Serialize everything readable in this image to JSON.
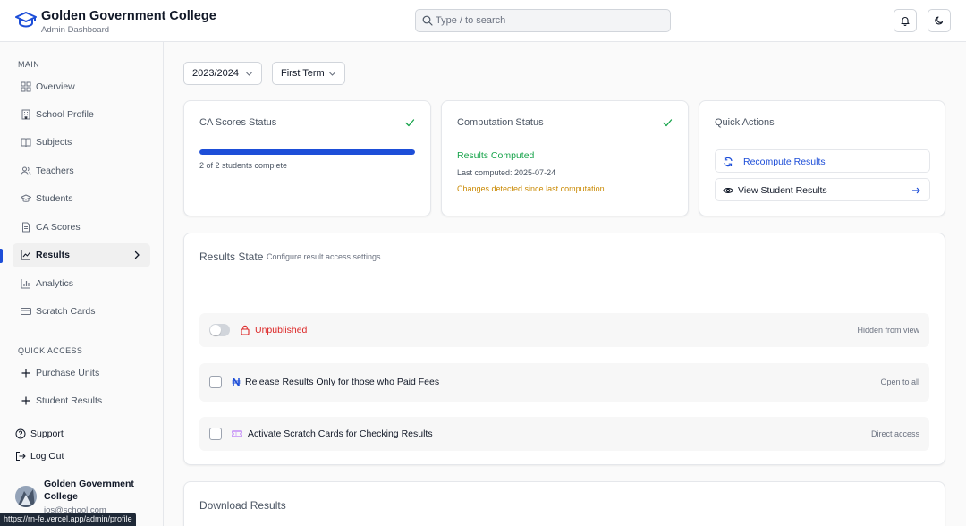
{
  "header": {
    "title": "Golden Government College",
    "subtitle": "Admin Dashboard",
    "search_placeholder": "Type / to search",
    "logo_icon": "graduation-cap-icon",
    "notification_icon": "bell-icon",
    "theme_icon": "moon-icon"
  },
  "sidebar": {
    "main_label": "MAIN",
    "items": [
      {
        "label": "Overview",
        "icon": "grid-icon"
      },
      {
        "label": "School Profile",
        "icon": "building-icon"
      },
      {
        "label": "Subjects",
        "icon": "book-icon"
      },
      {
        "label": "Teachers",
        "icon": "users-icon"
      },
      {
        "label": "Students",
        "icon": "graduation-cap-icon"
      },
      {
        "label": "CA Scores",
        "icon": "file-icon"
      },
      {
        "label": "Results",
        "icon": "chart-line-icon",
        "active": true
      },
      {
        "label": "Analytics",
        "icon": "bar-chart-icon"
      },
      {
        "label": "Scratch Cards",
        "icon": "credit-card-icon"
      }
    ],
    "quick_label": "QUICK ACCESS",
    "quick_items": [
      {
        "label": "Purchase Units",
        "icon": "plus-icon"
      },
      {
        "label": "Student Results",
        "icon": "plus-icon"
      }
    ],
    "support_label": "Support",
    "logout_label": "Log Out",
    "profile": {
      "name": "Golden Government College",
      "email": "jos@school.com"
    },
    "url_tooltip": "https://rn-fe.vercel.app/admin/profile"
  },
  "filters": {
    "session": "2023/2024",
    "term": "First Term"
  },
  "ca_status": {
    "title": "CA Scores Status",
    "progress_text": "2 of 2 students complete",
    "progress_fraction": 1.0
  },
  "computation": {
    "title": "Computation Status",
    "status": "Results Computed",
    "last_computed": "Last computed: 2025-07-24",
    "warning": "Changes detected since last computation"
  },
  "quick_actions": {
    "title": "Quick Actions",
    "recompute_label": "Recompute Results",
    "view_label": "View Student Results"
  },
  "results_state": {
    "title": "Results State",
    "subtitle": "Configure result access settings",
    "publish": {
      "label": "Unpublished",
      "right": "Hidden from view",
      "enabled": false
    },
    "release": {
      "label": "Release Results Only for those who Paid Fees",
      "right": "Open to all",
      "checked": false
    },
    "scratch": {
      "label": "Activate Scratch Cards for Checking Results",
      "right": "Direct access",
      "checked": false
    }
  },
  "download": {
    "title": "Download Results"
  },
  "colors": {
    "accent": "#1d4ed8",
    "success": "#16a34a",
    "warning": "#ca8a04",
    "danger": "#dc2626"
  }
}
